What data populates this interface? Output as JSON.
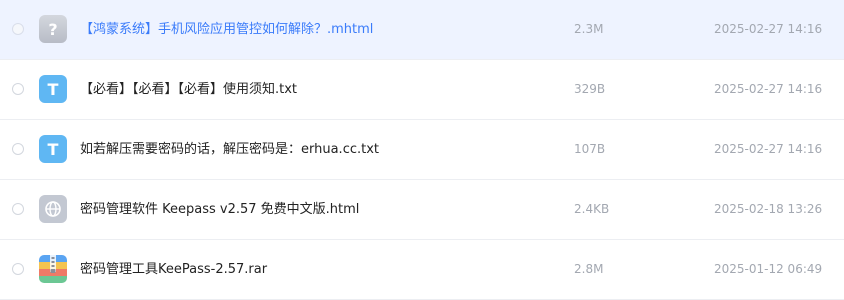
{
  "files": [
    {
      "name": "【鸿蒙系统】手机风险应用管控如何解除？.mhtml",
      "size": "2.3M",
      "date": "2025-02-27 14:16",
      "icon": "unknown-file-icon"
    },
    {
      "name": "【必看】【必看】【必看】使用须知.txt",
      "size": "329B",
      "date": "2025-02-27 14:16",
      "icon": "text-file-icon"
    },
    {
      "name": "如若解压需要密码的话，解压密码是：erhua.cc.txt",
      "size": "107B",
      "date": "2025-02-27 14:16",
      "icon": "text-file-icon"
    },
    {
      "name": "密码管理软件 Keepass v2.57 免费中文版.html",
      "size": "2.4KB",
      "date": "2025-02-18 13:26",
      "icon": "web-file-icon"
    },
    {
      "name": "密码管理工具KeePass-2.57.rar",
      "size": "2.8M",
      "date": "2025-01-12 06:49",
      "icon": "archive-file-icon"
    }
  ],
  "colors": {
    "selected_row_bg": "#eef3ff",
    "selected_name": "#3a7bfa",
    "text_icon": "#5fb7f3",
    "meta_text": "#a3a8b1"
  }
}
